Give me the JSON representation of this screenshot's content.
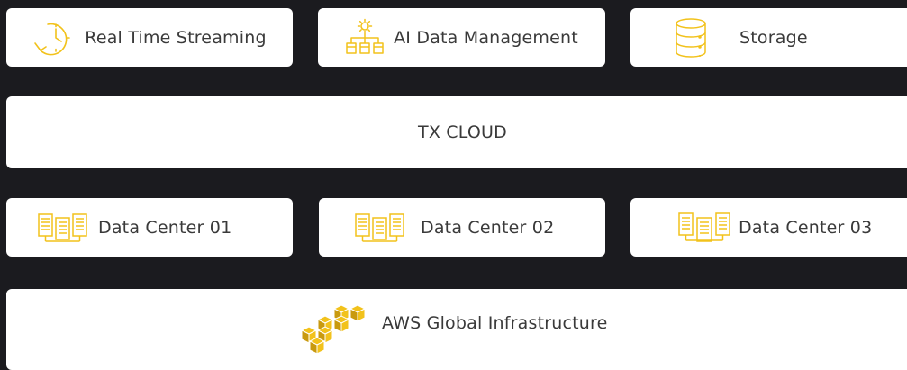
{
  "services": {
    "realtime": {
      "label": "Real Time Streaming",
      "icon": "clock-arrow-icon"
    },
    "ai": {
      "label": "AI Data Management",
      "icon": "gear-hierarchy-icon"
    },
    "storage": {
      "label": "Storage",
      "icon": "database-icon"
    }
  },
  "cloud": {
    "label": "TX CLOUD"
  },
  "datacenters": [
    {
      "label": "Data Center 01",
      "icon": "servers-icon"
    },
    {
      "label": "Data Center 02",
      "icon": "servers-icon"
    },
    {
      "label": "Data Center 03",
      "icon": "servers-icon"
    }
  ],
  "infrastructure": {
    "label": "AWS Global Infrastructure",
    "icon": "aws-cubes-icon"
  },
  "colors": {
    "background": "#1b1b1f",
    "box": "#ffffff",
    "icon_accent": "#f2c21b",
    "text": "#3a3a3a"
  }
}
